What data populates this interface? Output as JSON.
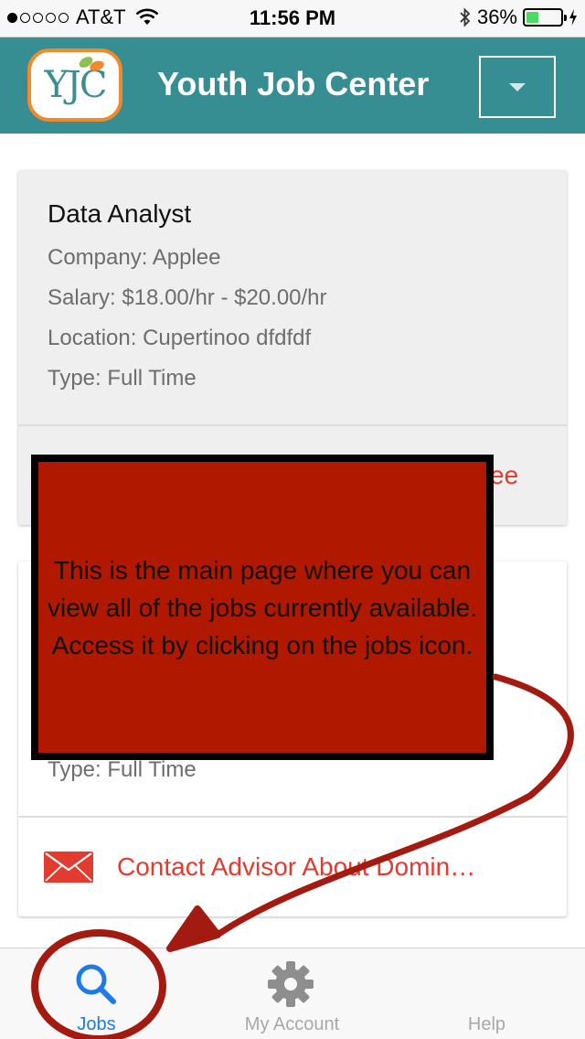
{
  "status_bar": {
    "carrier": "AT&T",
    "time": "11:56 PM",
    "battery_percent": "36%",
    "battery_level": 0.36,
    "signal_bars_filled": 1,
    "signal_bars_total": 5
  },
  "header": {
    "logo_text": "YJC",
    "title": "Youth Job Center",
    "background_color": "#368e92",
    "logo_border_color": "#f08a2c"
  },
  "jobs": [
    {
      "title": "Data Analyst",
      "company": "Company: Applee",
      "salary": "Salary: $18.00/hr - $20.00/hr",
      "location": "Location: Cupertinoo dfdfdf",
      "type": "Type: Full Time",
      "contact_label": "ee"
    },
    {
      "type": "Type: Full Time",
      "contact_label": "Contact Advisor About Domin…"
    }
  ],
  "tutorial": {
    "text": "This is the main page where you can view all of the jobs currently available. Access it by clicking on the jobs icon.",
    "box_color": "#b11800",
    "arrow_color": "#a31a10"
  },
  "tab_bar": {
    "tabs": [
      {
        "label": "Jobs",
        "icon": "search-icon",
        "active": true
      },
      {
        "label": "My Account",
        "icon": "gear-icon",
        "active": false
      },
      {
        "label": "Help",
        "icon": "help-icon",
        "active": false
      }
    ],
    "active_color": "#1e7ae6",
    "inactive_color": "#a8a8a8"
  },
  "accent_color": "#e23b2f"
}
